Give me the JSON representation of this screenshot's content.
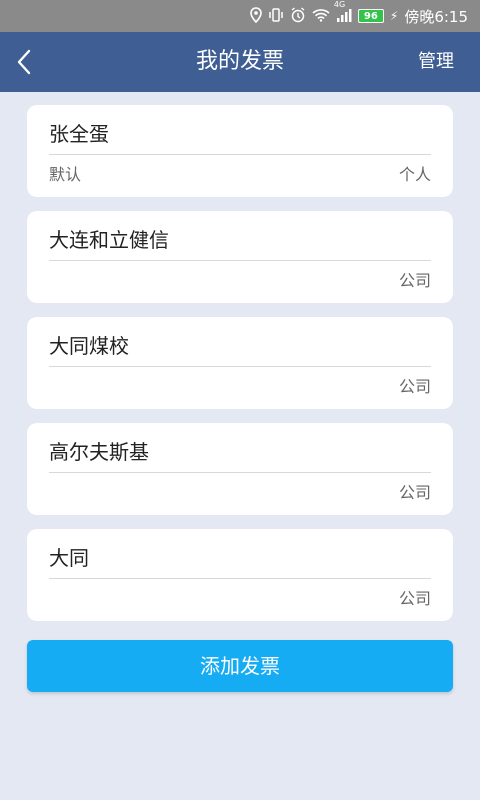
{
  "status_bar": {
    "battery": "96",
    "time": "傍晚6:15",
    "network": "4G",
    "icons": [
      "location-icon",
      "vibrate-icon",
      "alarm-icon",
      "wifi-icon",
      "signal-icon",
      "battery-icon",
      "charging-icon"
    ]
  },
  "nav": {
    "title": "我的发票",
    "manage": "管理",
    "back_icon": "chevron-left-icon"
  },
  "invoices": [
    {
      "name": "张全蛋",
      "tag": "默认",
      "type": "个人"
    },
    {
      "name": "大连和立健信",
      "tag": "",
      "type": "公司"
    },
    {
      "name": "大同煤校",
      "tag": "",
      "type": "公司"
    },
    {
      "name": "高尔夫斯基",
      "tag": "",
      "type": "公司"
    },
    {
      "name": "大同",
      "tag": "",
      "type": "公司"
    }
  ],
  "add_button": "添加发票",
  "colors": {
    "status_bar": "#8a8a8a",
    "nav_bar": "#3f5e93",
    "background": "#e4e8f2",
    "primary_button": "#16acf4",
    "battery": "#33c34a"
  }
}
